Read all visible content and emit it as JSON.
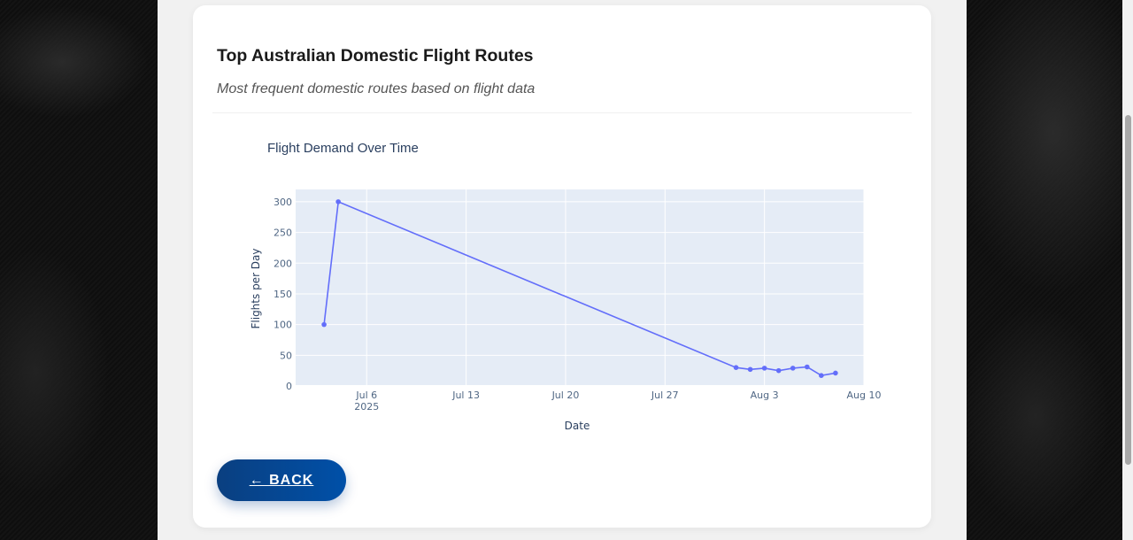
{
  "page": {
    "title": "Top Australian Domestic Flight Routes",
    "subtitle": "Most frequent domestic routes based on flight data",
    "back_label": "← BACK"
  },
  "colors": {
    "plot_bg": "#e5ecf6",
    "line": "#636efa",
    "button": "#0a4a94"
  },
  "chart_data": {
    "type": "line",
    "title": "Flight Demand Over Time",
    "xlabel": "Date",
    "ylabel": "Flights per Day",
    "x_ticks": [
      {
        "date": "2025-07-06",
        "label": "Jul 6",
        "sub": "2025"
      },
      {
        "date": "2025-07-13",
        "label": "Jul 13",
        "sub": ""
      },
      {
        "date": "2025-07-20",
        "label": "Jul 20",
        "sub": ""
      },
      {
        "date": "2025-07-27",
        "label": "Jul 27",
        "sub": ""
      },
      {
        "date": "2025-08-03",
        "label": "Aug 3",
        "sub": ""
      },
      {
        "date": "2025-08-10",
        "label": "Aug 10",
        "sub": ""
      }
    ],
    "y_ticks": [
      0,
      50,
      100,
      150,
      200,
      250,
      300
    ],
    "xlim": [
      "2025-07-01",
      "2025-08-10"
    ],
    "ylim": [
      0,
      320
    ],
    "grid": true,
    "series": [
      {
        "points": [
          {
            "x": "2025-07-03",
            "y": 100
          },
          {
            "x": "2025-07-04",
            "y": 300
          },
          {
            "x": "2025-08-01",
            "y": 30
          },
          {
            "x": "2025-08-02",
            "y": 27
          },
          {
            "x": "2025-08-03",
            "y": 29
          },
          {
            "x": "2025-08-04",
            "y": 25
          },
          {
            "x": "2025-08-05",
            "y": 29
          },
          {
            "x": "2025-08-06",
            "y": 31
          },
          {
            "x": "2025-08-07",
            "y": 17
          },
          {
            "x": "2025-08-08",
            "y": 21
          }
        ]
      }
    ]
  }
}
